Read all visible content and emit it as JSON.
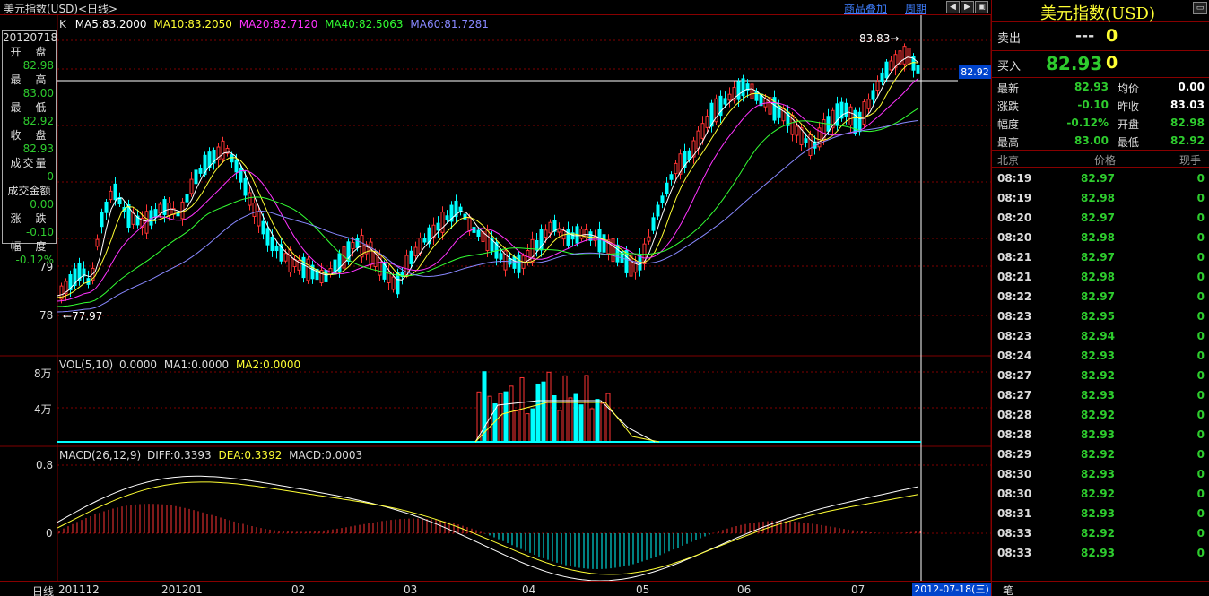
{
  "window": {
    "title": "美元指数(USD)<日线>",
    "links": [
      "商品叠加",
      "周期"
    ],
    "btn_icons": [
      "prev-icon",
      "next-icon",
      "restore-icon"
    ]
  },
  "main": {
    "k_label": "K",
    "ma": [
      {
        "text": "MA5:83.2000",
        "color": "#ffffff"
      },
      {
        "text": "MA10:83.2050",
        "color": "#ffff33"
      },
      {
        "text": "MA20:82.7120",
        "color": "#ff33ff"
      },
      {
        "text": "MA40:82.5063",
        "color": "#33ff33"
      },
      {
        "text": "MA60:81.7281",
        "color": "#8888ff"
      }
    ],
    "price_ticks": [
      "79",
      "78"
    ],
    "high_label": "83.83",
    "low_label": "77.97",
    "cursor_price": "82.92"
  },
  "info_box": {
    "date": "20120718",
    "items": [
      {
        "label": "开　盘",
        "value": "82.98"
      },
      {
        "label": "最　高",
        "value": "83.00"
      },
      {
        "label": "最　低",
        "value": "82.92"
      },
      {
        "label": "收　盘",
        "value": "82.93"
      },
      {
        "label": "成交量",
        "value": "0"
      },
      {
        "label": "成交金额",
        "value": "0.00"
      },
      {
        "label": "涨　跌",
        "value": "-0.10"
      },
      {
        "label": "幅　度",
        "value": "-0.12%"
      }
    ]
  },
  "volume": {
    "label": "VOL(5,10)",
    "val": "0.0000",
    "ma1": "MA1:0.0000",
    "ma2": "MA2:0.0000",
    "ticks": [
      "8万",
      "4万"
    ]
  },
  "macd": {
    "label": "MACD(26,12,9)",
    "diff": "DIFF:0.3393",
    "dea": "DEA:0.3392",
    "macd": "MACD:0.0003",
    "ticks": [
      "0.8",
      "0"
    ]
  },
  "xaxis": {
    "period_label": "日线",
    "labels": [
      "201112",
      "201201",
      "02",
      "03",
      "04",
      "05",
      "06",
      "07"
    ],
    "cursor_date": "2012-07-18(三)"
  },
  "quote": {
    "title": "美元指数(USD)",
    "sell_label": "卖出",
    "sell_price": "---",
    "sell_vol": "0",
    "buy_label": "买入",
    "buy_price": "82.93",
    "buy_vol": "0",
    "stats": [
      {
        "l1": "最新",
        "v1": "82.93",
        "l2": "均价",
        "v2": "0.00",
        "c1": "#2ecc2e",
        "c2": "#ffffff"
      },
      {
        "l1": "涨跌",
        "v1": "-0.10",
        "l2": "昨收",
        "v2": "83.03",
        "c1": "#2ecc2e",
        "c2": "#ffffff"
      },
      {
        "l1": "幅度",
        "v1": "-0.12%",
        "l2": "开盘",
        "v2": "82.98",
        "c1": "#2ecc2e",
        "c2": "#2ecc2e"
      },
      {
        "l1": "最高",
        "v1": "83.00",
        "l2": "最低",
        "v2": "82.92",
        "c1": "#2ecc2e",
        "c2": "#2ecc2e"
      }
    ],
    "tick_headers": [
      "北京",
      "价格",
      "现手"
    ],
    "ticks": [
      [
        "08:19",
        "82.97",
        "0"
      ],
      [
        "08:19",
        "82.98",
        "0"
      ],
      [
        "08:20",
        "82.97",
        "0"
      ],
      [
        "08:20",
        "82.98",
        "0"
      ],
      [
        "08:21",
        "82.97",
        "0"
      ],
      [
        "08:21",
        "82.98",
        "0"
      ],
      [
        "08:22",
        "82.97",
        "0"
      ],
      [
        "08:23",
        "82.95",
        "0"
      ],
      [
        "08:23",
        "82.94",
        "0"
      ],
      [
        "08:24",
        "82.93",
        "0"
      ],
      [
        "08:27",
        "82.92",
        "0"
      ],
      [
        "08:27",
        "82.93",
        "0"
      ],
      [
        "08:28",
        "82.92",
        "0"
      ],
      [
        "08:28",
        "82.93",
        "0"
      ],
      [
        "08:29",
        "82.92",
        "0"
      ],
      [
        "08:30",
        "82.93",
        "0"
      ],
      [
        "08:30",
        "82.92",
        "0"
      ],
      [
        "08:31",
        "82.93",
        "0"
      ],
      [
        "08:33",
        "82.92",
        "0"
      ],
      [
        "08:33",
        "82.93",
        "0"
      ]
    ],
    "bottom_tab": "笔"
  },
  "colors": {
    "up": "#ff3333",
    "down": "#00ffff",
    "grid": "#800000",
    "green": "#2ecc2e",
    "yellow": "#ffff33"
  }
}
